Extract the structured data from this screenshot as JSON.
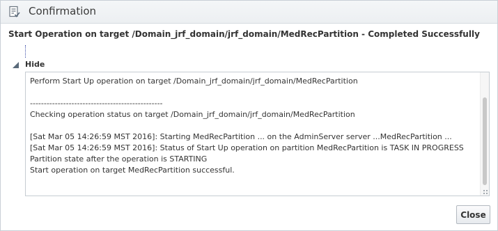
{
  "dialog": {
    "title": "Confirmation",
    "title_icon": "checklist-icon",
    "heading": "Start Operation on target /Domain_jrf_domain/jrf_domain/MedRecPartition - Completed Successfully",
    "toggle_label": "Hide",
    "log_lines": [
      "Perform Start Up operation on target /Domain_jrf_domain/jrf_domain/MedRecPartition",
      "",
      "------------------------------------------------",
      "Checking operation status on target /Domain_jrf_domain/jrf_domain/MedRecPartition",
      "",
      "[Sat Mar 05 14:26:59 MST 2016]: Starting MedRecPartition ... on the AdminServer server ...MedRecPartition ...",
      "[Sat Mar 05 14:26:59 MST 2016]: Status of Start Up operation on partition MedRecPartition is TASK IN PROGRESS",
      "Partition state after the operation is STARTING",
      "Start operation on target MedRecPartition successful."
    ],
    "close_label": "Close"
  }
}
